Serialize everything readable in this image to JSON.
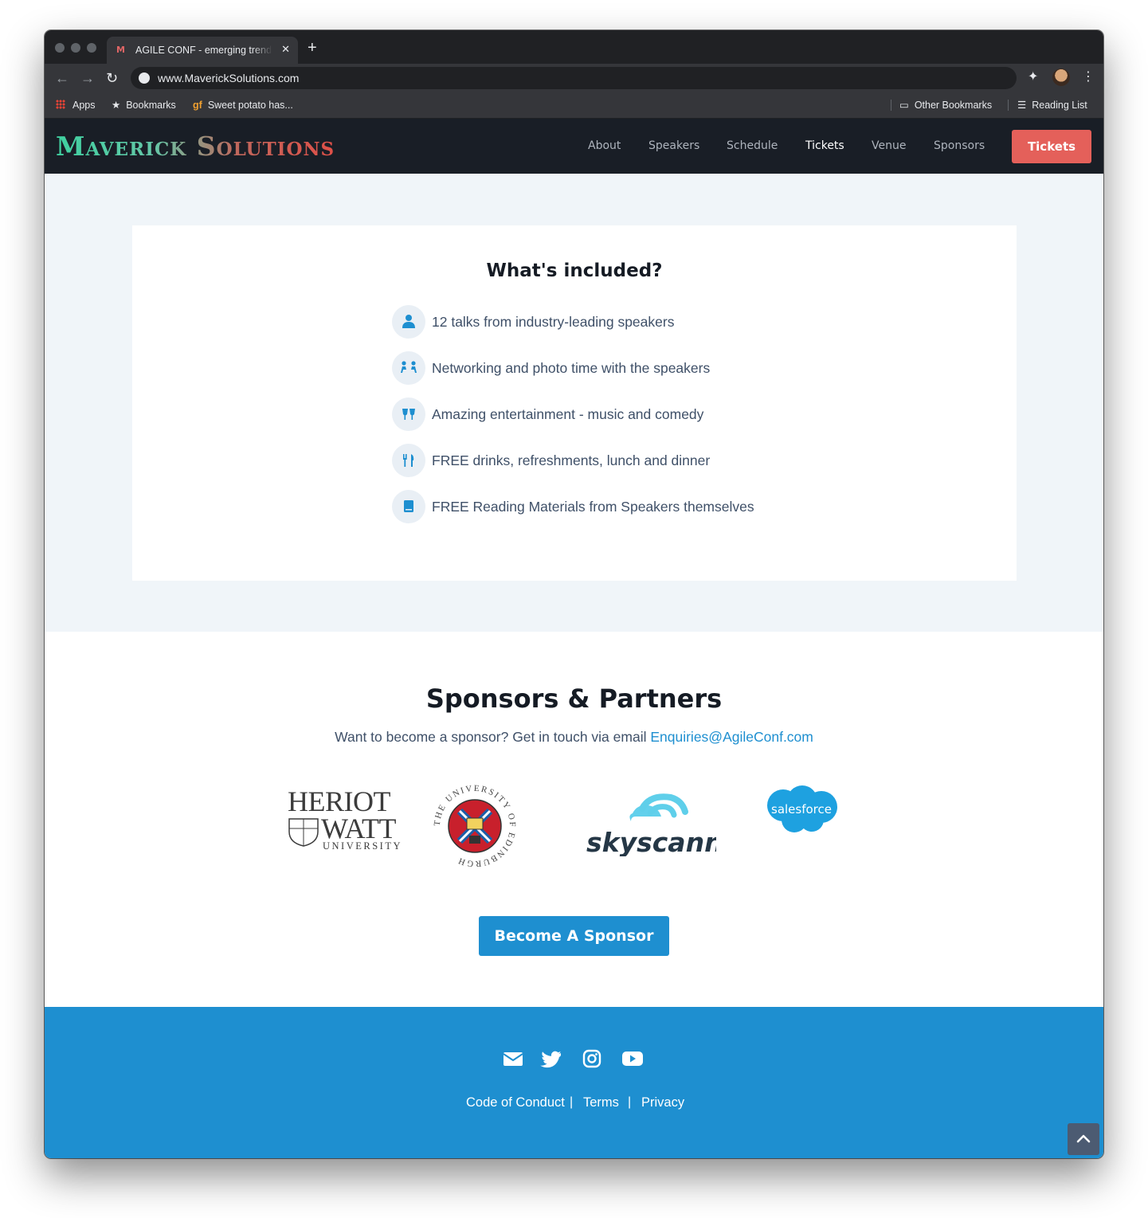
{
  "browser": {
    "tab_title": "AGILE CONF - emerging trends",
    "tab_favicon": "M",
    "url": "www.MaverickSolutions.com",
    "bookmarks": {
      "apps": "Apps",
      "bookmarks": "Bookmarks",
      "sweet_potato": "Sweet potato has...",
      "other": "Other Bookmarks",
      "reading_list": "Reading List"
    }
  },
  "site": {
    "logo_text": "Maverick Solutions",
    "nav": [
      "About",
      "Speakers",
      "Schedule",
      "Tickets",
      "Venue",
      "Sponsors"
    ],
    "nav_active": "Tickets",
    "cta": "Tickets"
  },
  "included": {
    "title": "What's included?",
    "items": [
      {
        "icon": "speaker-icon",
        "text": "12 talks from industry-leading speakers"
      },
      {
        "icon": "people-networking-icon",
        "text": "Networking and photo time with the speakers"
      },
      {
        "icon": "glasses-cheers-icon",
        "text": "Amazing entertainment - music and comedy"
      },
      {
        "icon": "utensils-icon",
        "text": "FREE drinks, refreshments, lunch and dinner"
      },
      {
        "icon": "book-icon",
        "text": "FREE Reading Materials from Speakers themselves"
      }
    ]
  },
  "sponsors": {
    "title": "Sponsors & Partners",
    "intro": "Want to become a sponsor? Get in touch via email",
    "email": "Enquiries@AgileConf.com",
    "logos": {
      "heriot_watt": [
        "HERIOT",
        "WATT",
        "UNIVERSITY"
      ],
      "edinburgh": "THE UNIVERSITY OF EDINBURGH",
      "skyscanner": "skyscanner",
      "salesforce": "salesforce"
    },
    "button": "Become A Sponsor"
  },
  "footer": {
    "social": [
      "envelope-icon",
      "twitter-icon",
      "instagram-icon",
      "youtube-icon"
    ],
    "links": [
      "Code of Conduct",
      "Terms",
      "Privacy"
    ],
    "separator": "|"
  },
  "colors": {
    "accent": "#1e8fd0",
    "cta": "#e4605a",
    "nav_bg": "#191e26",
    "section_bg": "#f0f5f9",
    "text": "#3f5068",
    "heading": "#151b24"
  }
}
